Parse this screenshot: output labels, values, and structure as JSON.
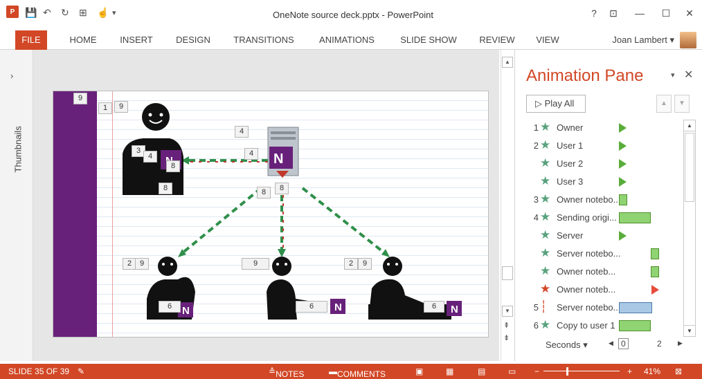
{
  "title": {
    "document": "OneNote source deck.pptx - PowerPoint"
  },
  "window": {
    "help": "?",
    "restore_ribbon": "⊡",
    "minimize": "—",
    "maximize": "☐",
    "close": "✕"
  },
  "qat": {
    "app_icon": "P",
    "save": "💾",
    "undo": "↶",
    "redo": "↻",
    "present": "⊞",
    "touch": "☝",
    "more": "▾"
  },
  "ribbon": {
    "tabs": [
      "FILE",
      "HOME",
      "INSERT",
      "DESIGN",
      "TRANSITIONS",
      "ANIMATIONS",
      "SLIDE SHOW",
      "REVIEW",
      "VIEW"
    ],
    "user": "Joan Lambert"
  },
  "thumbnails": {
    "expand": "›",
    "label": "Thumbnails"
  },
  "slide": {
    "badges": [
      "9",
      "1",
      "9",
      "4",
      "3",
      "4",
      "4",
      "8",
      "8",
      "8",
      "8",
      "2",
      "9",
      "9",
      "2",
      "9",
      "6",
      "6",
      "6"
    ]
  },
  "pane": {
    "title": "Animation Pane",
    "play_all": "Play All",
    "items": [
      {
        "num": "1",
        "name": "Owner",
        "icon": "star",
        "timing": "triangle"
      },
      {
        "num": "2",
        "name": "User 1",
        "icon": "star",
        "timing": "triangle"
      },
      {
        "num": "",
        "name": "User 2",
        "icon": "star",
        "timing": "triangle"
      },
      {
        "num": "",
        "name": "User 3",
        "icon": "star",
        "timing": "triangle"
      },
      {
        "num": "3",
        "name": "Owner notebo...",
        "icon": "star",
        "timing": "bar"
      },
      {
        "num": "4",
        "name": "Sending origi...",
        "icon": "star",
        "timing": "bar"
      },
      {
        "num": "",
        "name": "Server",
        "icon": "star",
        "timing": "triangle"
      },
      {
        "num": "",
        "name": "Server notebo...",
        "icon": "star",
        "timing": "bar"
      },
      {
        "num": "",
        "name": "Owner noteb...",
        "icon": "star",
        "timing": "bar"
      },
      {
        "num": "",
        "name": "Owner noteb...",
        "icon": "star-red",
        "timing": "triangle-red"
      },
      {
        "num": "5",
        "name": "Server notebo...",
        "icon": "path",
        "timing": "bar-blue"
      },
      {
        "num": "6",
        "name": "Copy to user 1",
        "icon": "star",
        "timing": "bar"
      }
    ],
    "seconds": "Seconds ▾",
    "timeline": {
      "start": "0",
      "mid": "2"
    }
  },
  "status": {
    "slide": "SLIDE 35 OF 39",
    "notes": "NOTES",
    "comments": "COMMENTS",
    "zoom": "41%"
  },
  "colors": {
    "accent": "#d24726",
    "onenote": "#68217a",
    "pane_star": "#59a27e",
    "timing_green": "#8fd373"
  }
}
